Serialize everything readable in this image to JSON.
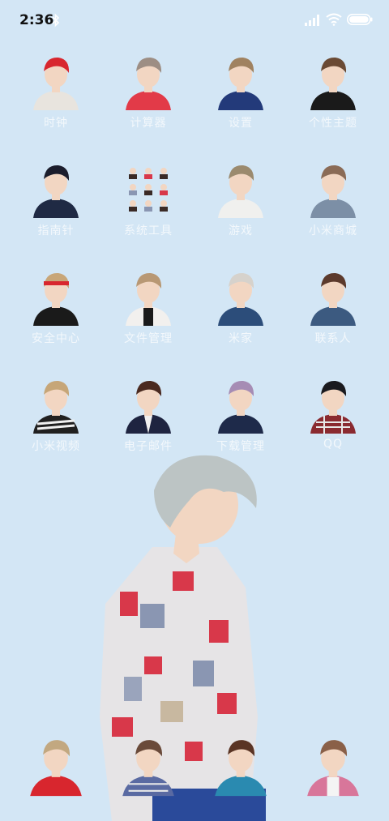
{
  "status_bar": {
    "time": "2:36",
    "icons": [
      "bluetooth-icon",
      "signal-icon",
      "wifi-icon",
      "battery-icon"
    ]
  },
  "apps": [
    {
      "label": "时钟",
      "icon": "clock-app-icon",
      "colors": {
        "hair": "#d8262e",
        "top": "#e8e4de"
      }
    },
    {
      "label": "计算器",
      "icon": "calculator-app-icon",
      "colors": {
        "hair": "#9d8e84",
        "top": "#e23a48"
      }
    },
    {
      "label": "设置",
      "icon": "settings-app-icon",
      "colors": {
        "hair": "#a08260",
        "top": "#233a7a"
      }
    },
    {
      "label": "个性主题",
      "icon": "themes-app-icon",
      "colors": {
        "hair": "#6a4a34",
        "top": "#1a1a1a"
      }
    },
    {
      "label": "指南针",
      "icon": "compass-app-icon",
      "colors": {
        "hair": "#1b1d2c",
        "top": "#1f2a44"
      }
    },
    {
      "label": "系统工具",
      "icon": "system-tools-app-icon",
      "colors": {
        "hair": "#3a2a26",
        "top": "#eae6e2"
      }
    },
    {
      "label": "游戏",
      "icon": "games-app-icon",
      "colors": {
        "hair": "#9b8a6e",
        "top": "#f0f0ee"
      }
    },
    {
      "label": "小米商城",
      "icon": "mi-store-app-icon",
      "colors": {
        "hair": "#8a6b56",
        "top": "#7c8fa6"
      }
    },
    {
      "label": "安全中心",
      "icon": "security-app-icon",
      "colors": {
        "hair": "#c8a678",
        "top": "#1a1a1a"
      }
    },
    {
      "label": "文件管理",
      "icon": "file-manager-app-icon",
      "colors": {
        "hair": "#b89874",
        "top": "#f2f0ee"
      }
    },
    {
      "label": "米家",
      "icon": "mijia-app-icon",
      "colors": {
        "hair": "#d6d2cc",
        "top": "#2c4d7a"
      }
    },
    {
      "label": "联系人",
      "icon": "contacts-app-icon",
      "colors": {
        "hair": "#5c3a2c",
        "top": "#3c5a80"
      }
    },
    {
      "label": "小米视频",
      "icon": "mi-video-app-icon",
      "colors": {
        "hair": "#c6a678",
        "top": "#202020"
      }
    },
    {
      "label": "电子邮件",
      "icon": "email-app-icon",
      "colors": {
        "hair": "#4a2a20",
        "top": "#1e2440"
      }
    },
    {
      "label": "下载管理",
      "icon": "downloads-app-icon",
      "colors": {
        "hair": "#a68cb4",
        "top": "#1e2a4a"
      }
    },
    {
      "label": "QQ",
      "icon": "qq-app-icon",
      "colors": {
        "hair": "#1a1a1e",
        "top": "#8a2a30"
      }
    }
  ],
  "dock": [
    {
      "icon": "dock-phone-icon",
      "colors": {
        "hair": "#c2a880",
        "top": "#d8262e"
      }
    },
    {
      "icon": "dock-messages-icon",
      "colors": {
        "hair": "#6a4a3a",
        "top": "#5a6aa2"
      }
    },
    {
      "icon": "dock-browser-icon",
      "colors": {
        "hair": "#5a3424",
        "top": "#2a8ab0"
      }
    },
    {
      "icon": "dock-camera-icon",
      "colors": {
        "hair": "#8a6048",
        "top": "#d8769a"
      }
    }
  ],
  "colors": {
    "wallpaper": "#d3e6f5",
    "label": "#f3f8fc",
    "skin": "#f2d6c2"
  }
}
